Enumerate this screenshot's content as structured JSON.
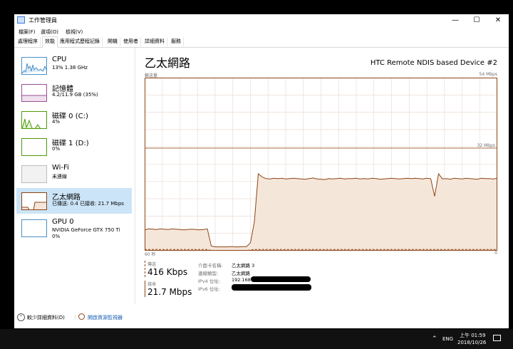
{
  "window": {
    "title": "工作管理員",
    "minimize": "—",
    "maximize": "☐",
    "close": "✕"
  },
  "menu": [
    "檔案(F)",
    "選項(O)",
    "檢視(V)"
  ],
  "tabs": [
    "處理程序",
    "效能",
    "應用程式歷程記錄",
    "開機",
    "使用者",
    "詳細資料",
    "服務"
  ],
  "sidebar": [
    {
      "name": "CPU",
      "sub1": "13%  1.38 GHz",
      "sub2": ""
    },
    {
      "name": "記憶體",
      "sub1": "4.2/11.9 GB (35%)",
      "sub2": ""
    },
    {
      "name": "磁碟 0 (C:)",
      "sub1": "4%",
      "sub2": ""
    },
    {
      "name": "磁碟 1 (D:)",
      "sub1": "0%",
      "sub2": ""
    },
    {
      "name": "Wi-Fi",
      "sub1": "未連線",
      "sub2": ""
    },
    {
      "name": "乙太網路",
      "sub1": "已傳送: 0.4  已接收: 21.7 Mbps",
      "sub2": ""
    },
    {
      "name": "GPU 0",
      "sub1": "NVIDIA GeForce GTX 750 Ti",
      "sub2": "0%"
    }
  ],
  "main": {
    "title": "乙太網路",
    "device": "HTC Remote NDIS based Device #2",
    "throughput_label": "輸送量",
    "max_label": "54 Mbps",
    "mid_label": "32 Mbps",
    "time_left": "60 秒",
    "time_right": "0"
  },
  "chart_data": {
    "type": "area",
    "title": "",
    "xlabel": "",
    "ylabel": "輸送量",
    "ylim": [
      0,
      54
    ],
    "x_range": [
      60,
      0
    ],
    "series": [
      {
        "values": [
          6.5,
          6.8,
          6.7,
          6.6,
          6.8,
          6.7,
          6.6,
          6.8,
          6.7,
          6.6,
          6.5,
          6.6,
          6.7,
          6.6,
          6.5,
          6.6,
          6.8,
          1.5,
          1.2,
          1.2,
          1.2,
          1.2,
          1.3,
          1.2,
          1.2,
          1.3,
          1.3,
          2.5,
          9,
          24,
          23,
          22.5,
          22.4,
          22.6,
          22.5,
          22.6,
          22.4,
          22.5,
          22.6,
          22.5,
          22.4,
          22.3,
          22.5,
          22.7,
          22.4,
          22.3,
          22.2,
          22.5,
          22.4,
          22.5,
          22.6,
          22.4,
          22.5,
          22.5,
          22.6,
          22.4,
          22.5,
          22.4,
          22.6,
          22.5,
          22.3,
          22.4,
          22.5,
          22.6,
          22.5,
          22.4,
          22.5,
          22.6,
          22.5,
          22.6,
          22.5,
          22.4,
          22.6,
          22.5,
          17,
          24,
          22.4,
          22.5,
          22.3,
          22.6,
          22.5,
          22.4,
          22.6,
          22.5,
          22.4,
          22.3,
          22.6,
          22.5,
          22.5,
          22.4,
          22.6
        ]
      },
      {
        "values": [
          0.4,
          0.4,
          0.4,
          0.4,
          0.4,
          0.4,
          0.4,
          0.4,
          0.4,
          0.4,
          0.4,
          0.4,
          0.4,
          0.4,
          0.4,
          0.4,
          0.4,
          0.1,
          0.1,
          0.1,
          0.1,
          0.1,
          0.1,
          0.1,
          0.1,
          0.1,
          0.1,
          0.2,
          0.4,
          0.4,
          0.4,
          0.4,
          0.4,
          0.4,
          0.4,
          0.4,
          0.4,
          0.4,
          0.4,
          0.4,
          0.4,
          0.4,
          0.4,
          0.4,
          0.4,
          0.4,
          0.4,
          0.4,
          0.4,
          0.4,
          0.4,
          0.4,
          0.4,
          0.4,
          0.4,
          0.4,
          0.4,
          0.4,
          0.4,
          0.4,
          0.4,
          0.4,
          0.4,
          0.4,
          0.4,
          0.4,
          0.4,
          0.4,
          0.4,
          0.4,
          0.4,
          0.4,
          0.4,
          0.4,
          0.4,
          0.4,
          0.4,
          0.4,
          0.4,
          0.4,
          0.4,
          0.4,
          0.4,
          0.4,
          0.4,
          0.4,
          0.4,
          0.4,
          0.4,
          0.4,
          0.4
        ]
      }
    ]
  },
  "stats": {
    "send_label": "傳送",
    "send_value": "416 Kbps",
    "recv_label": "接收",
    "recv_value": "21.7 Mbps"
  },
  "info": [
    {
      "k": "介面卡名稱:",
      "v": "乙太網路 3"
    },
    {
      "k": "連線類型:",
      "v": "乙太網路"
    },
    {
      "k": "IPv4 位址:",
      "v": "192.168"
    },
    {
      "k": "IPv6 位址:",
      "v": ""
    }
  ],
  "footer": {
    "less": "較少詳細資料(D)",
    "monitor": "開啟資源監視器"
  },
  "taskbar": {
    "lang": "ENG",
    "time": "上午 01:59",
    "date": "2018/10/26"
  },
  "colors": {
    "accent": "#8b4513",
    "fill": "#f5e6da",
    "grid": "#e8d8cc",
    "select": "#cce4f7"
  }
}
